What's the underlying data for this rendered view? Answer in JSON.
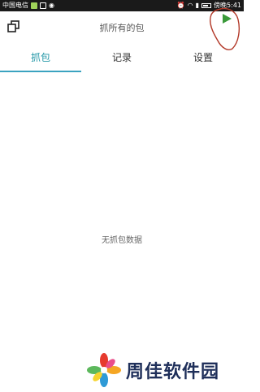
{
  "status_bar": {
    "carrier": "中国电信",
    "time": "傍晚5:41"
  },
  "toolbar": {
    "title": "抓所有的包",
    "copy_icon": "copy-icon",
    "play_icon": "play-icon"
  },
  "tabs": [
    {
      "label": "抓包",
      "active": true
    },
    {
      "label": "记录",
      "active": false
    },
    {
      "label": "设置",
      "active": false
    }
  ],
  "main": {
    "empty_text": "无抓包数据"
  },
  "watermark": {
    "text": "周佳软件园"
  },
  "colors": {
    "accent": "#2196a6",
    "play_green": "#3a9a3a",
    "annotation_red": "#c0392b"
  }
}
